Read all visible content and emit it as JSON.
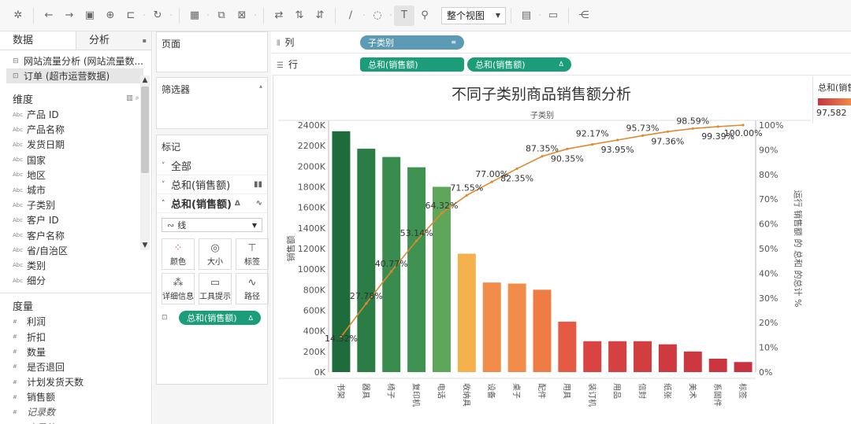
{
  "toolbar": {
    "view_mode": "整个视图"
  },
  "data_pane": {
    "tabs": [
      "数据",
      "分析"
    ],
    "datasources": [
      "网站流量分析 (网站流量数...",
      "订单 (超市运营数据)"
    ],
    "dimensions_title": "维度",
    "dimensions": [
      "产品 ID",
      "产品名称",
      "发货日期",
      "国家",
      "地区",
      "城市",
      "子类别",
      "客户 ID",
      "客户名称",
      "省/自治区",
      "类别",
      "细分"
    ],
    "measures_title": "度量",
    "measures": [
      "利润",
      "折扣",
      "数量",
      "是否退回",
      "计划发货天数",
      "销售额",
      "记录数",
      "度量值"
    ]
  },
  "cards": {
    "pages": "页面",
    "filters": "筛选器",
    "marks": "标记",
    "all": "全部",
    "sum_sales_1": "总和(销售额)",
    "sum_sales_2": "总和(销售额)",
    "mark_type": "线",
    "encodings": [
      "颜色",
      "大小",
      "标签",
      "详细信息",
      "工具提示",
      "路径"
    ],
    "path_pill": "总和(销售额)"
  },
  "shelves": {
    "columns_label": "列",
    "columns_pill": "子类别",
    "rows_label": "行",
    "rows_pills": [
      "总和(销售额)",
      "总和(销售额)"
    ]
  },
  "legend": {
    "title": "总和(销售额)",
    "min_value": "97,582",
    "colors": [
      "#c93340",
      "#f28c4a"
    ]
  },
  "chart_data": {
    "type": "bar",
    "title": "不同子类别商品销售额分析",
    "xlabel": "子类别",
    "ylabel": "销售额",
    "y2label": "运行 销售额 的 总和 的总计 %",
    "categories": [
      "书架",
      "器具",
      "椅子",
      "复印机",
      "电话",
      "收纳具",
      "设备",
      "桌子",
      "配件",
      "用具",
      "装订机",
      "用品",
      "信封",
      "纸张",
      "美术",
      "系固件",
      "标签"
    ],
    "values": [
      2340,
      2170,
      2090,
      1990,
      1800,
      1150,
      870,
      860,
      800,
      490,
      300,
      300,
      300,
      270,
      200,
      130,
      97.582
    ],
    "ylim": [
      0,
      2400
    ],
    "yticks": [
      "0K",
      "200K",
      "400K",
      "600K",
      "800K",
      "1000K",
      "1200K",
      "1400K",
      "1600K",
      "1800K",
      "2000K",
      "2200K",
      "2400K"
    ],
    "y2ticks": [
      "0%",
      "10%",
      "20%",
      "30%",
      "40%",
      "50%",
      "60%",
      "70%",
      "80%",
      "90%",
      "100%"
    ],
    "line_series": {
      "name": "运行 销售额 的 总和 的总计 %",
      "values": [
        14.32,
        27.78,
        40.77,
        53.14,
        64.32,
        71.55,
        77.0,
        82.35,
        87.35,
        90.35,
        92.17,
        93.95,
        95.73,
        97.36,
        98.59,
        99.39,
        100.0
      ],
      "labels": [
        "14.32%",
        "27.78%",
        "40.77%",
        "53.14%",
        "64.32%",
        "71.55%",
        "77.00%",
        "82.35%",
        "87.35%",
        "90.35%",
        "92.17%",
        "93.95%",
        "95.73%",
        "97.36%",
        "98.59%",
        "99.39%",
        "100.00%"
      ],
      "color": "#e08a2e"
    },
    "bar_colors": [
      "#1e6b3c",
      "#2b7d45",
      "#3a8b4e",
      "#3f9252",
      "#5ea65a",
      "#f4b14e",
      "#f28c4a",
      "#f28c4a",
      "#ef7b45",
      "#e65a43",
      "#d94342",
      "#d54041",
      "#d23d40",
      "#cf3a40",
      "#cd373f",
      "#cb3540",
      "#c93340"
    ]
  }
}
